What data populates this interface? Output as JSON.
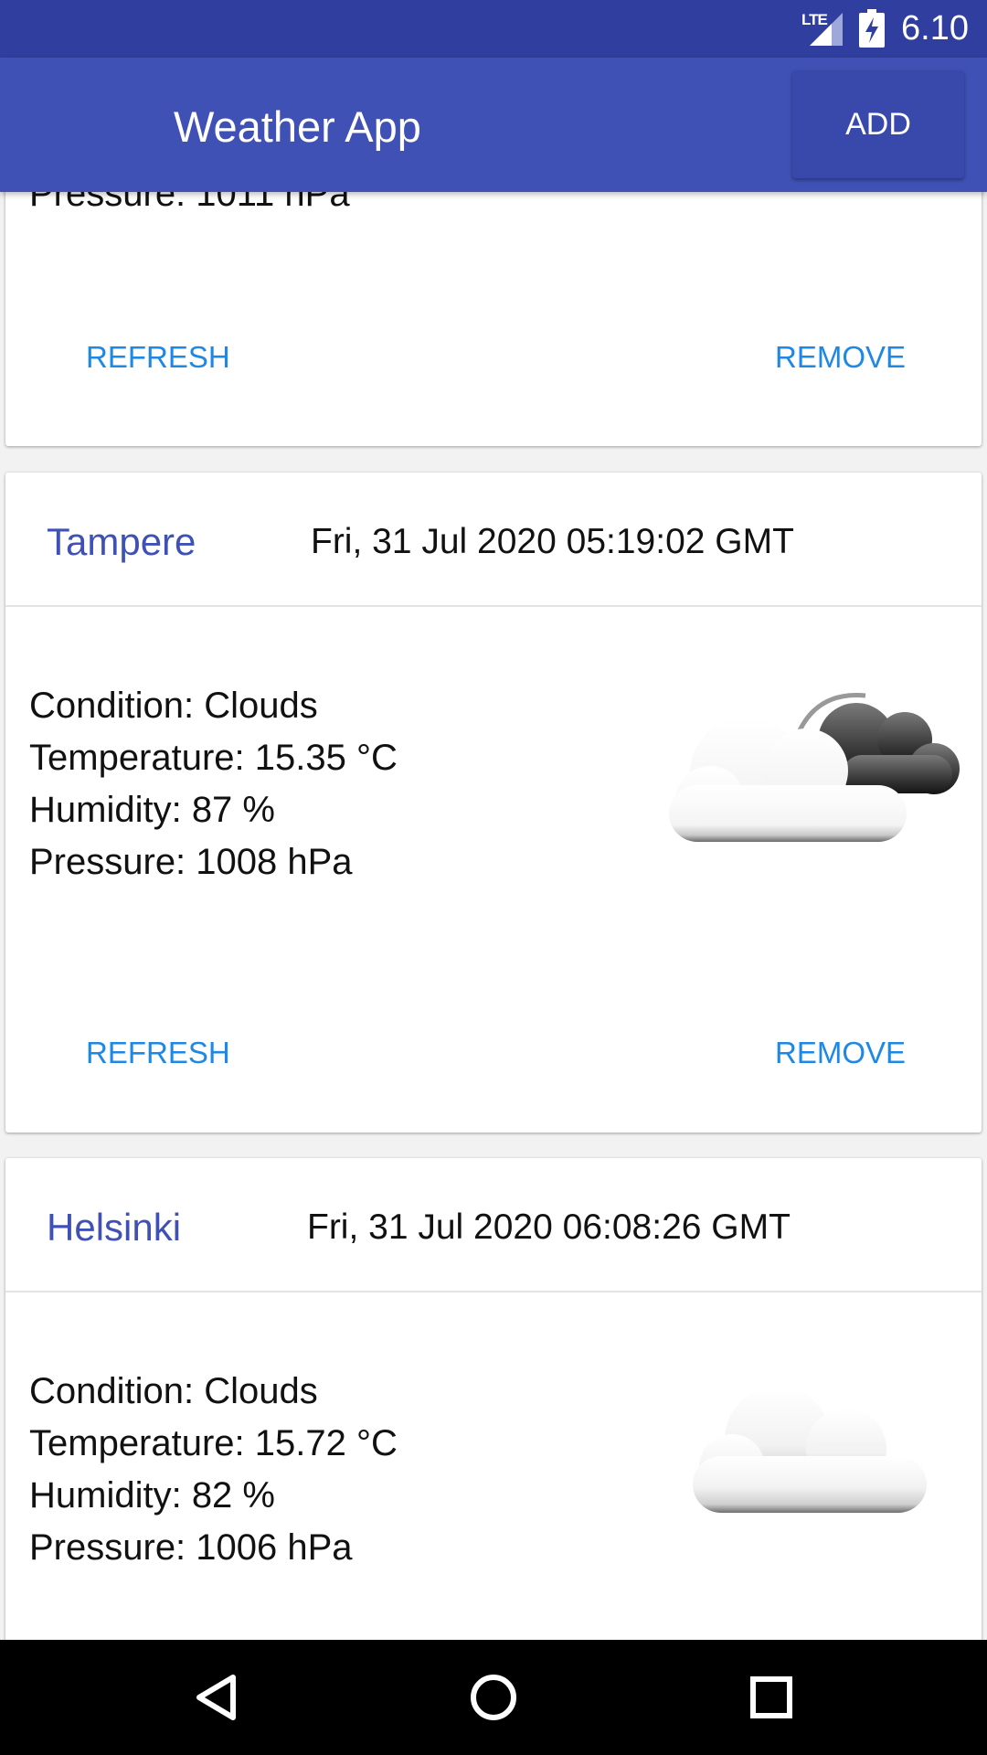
{
  "status_bar": {
    "network": "LTE",
    "time": "6.10"
  },
  "app_bar": {
    "title": "Weather App",
    "add_label": "ADD"
  },
  "cards": [
    {
      "partial_text": "Pressure: 1011 hPa",
      "refresh_label": "REFRESH",
      "remove_label": "REMOVE"
    },
    {
      "city": "Tampere",
      "datetime": "Fri, 31 Jul 2020 05:19:02 GMT",
      "condition": "Condition: Clouds",
      "temperature": "Temperature: 15.35 °C",
      "humidity": "Humidity: 87 %",
      "pressure": "Pressure: 1008 hPa",
      "icon": "clouds-dark-icon",
      "refresh_label": "REFRESH",
      "remove_label": "REMOVE"
    },
    {
      "city": "Helsinki",
      "datetime": "Fri, 31 Jul 2020 06:08:26 GMT",
      "condition": "Condition: Clouds",
      "temperature": "Temperature: 15.72 °C",
      "humidity": "Humidity: 82 %",
      "pressure": "Pressure: 1006 hPa",
      "icon": "cloud-icon"
    }
  ],
  "nav_bar": {
    "icons": [
      "back-icon",
      "home-icon",
      "recents-icon"
    ]
  }
}
